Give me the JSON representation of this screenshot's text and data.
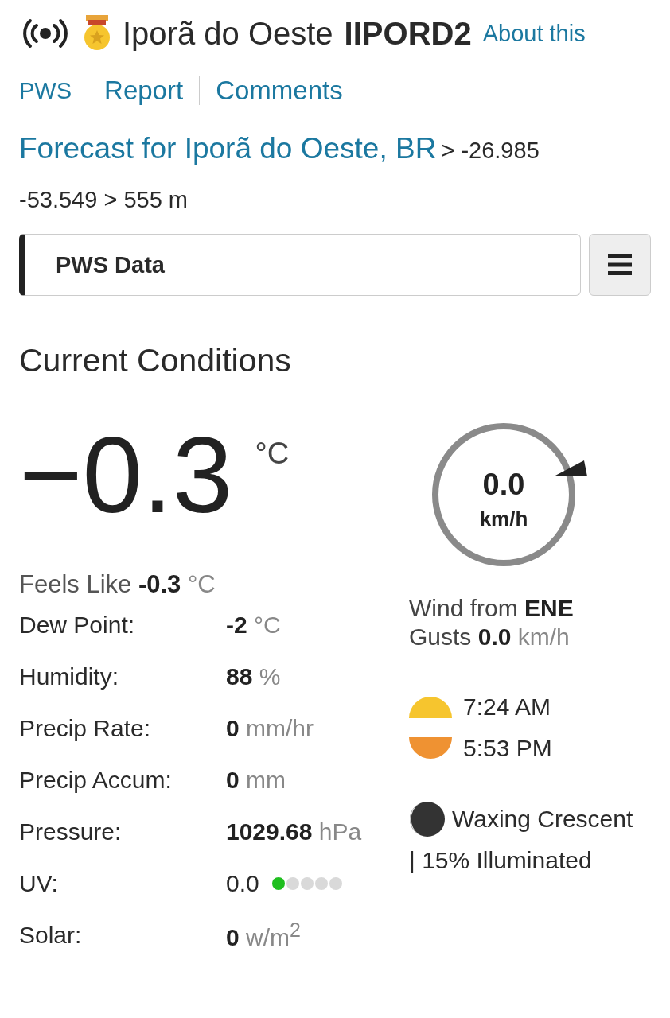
{
  "header": {
    "station_name": "Iporã do Oeste",
    "station_id": "IIPORD2",
    "about_link": "About this"
  },
  "nav": [
    {
      "label": "PWS"
    },
    {
      "label": "Report"
    },
    {
      "label": "Comments"
    }
  ],
  "forecast": {
    "link": "Forecast for Iporã do Oeste, BR",
    "location": "> -26.985 -53.549 > 555 m"
  },
  "data_menu": {
    "value": "PWS Data"
  },
  "section_title": "Current Conditions",
  "temperature": {
    "value": "−0.3",
    "unit": "°C"
  },
  "feels_like": {
    "label": "Feels Like",
    "value": "-0.3",
    "unit": "°C"
  },
  "rows": [
    {
      "kind": "value",
      "label": "Dew Point:",
      "value": "-2",
      "unit": "°C"
    },
    {
      "kind": "value",
      "label": "Humidity:",
      "value": "88",
      "unit": "%"
    },
    {
      "kind": "value",
      "label": "Precip Rate:",
      "value": "0",
      "unit": "mm/hr"
    },
    {
      "kind": "value",
      "label": "Precip Accum:",
      "value": "0",
      "unit": "mm"
    },
    {
      "kind": "value",
      "label": "Pressure:",
      "value": "1029.68",
      "unit": "hPa"
    },
    {
      "kind": "index",
      "label": "UV:",
      "value": "0.0",
      "dots": [
        {
          "color": "#1fbf1f"
        },
        {
          "color": "#d9d9d9"
        },
        {
          "color": "#d9d9d9"
        },
        {
          "color": "#d9d9d9"
        },
        {
          "color": "#d9d9d9"
        }
      ]
    },
    {
      "kind": "value",
      "label": "Solar:",
      "value": "0",
      "unit": "w/m$^{2}$"
    }
  ],
  "wind": {
    "speed": "0.0",
    "unit": "km/h",
    "from_label": "Wind from",
    "direction": "ENE",
    "gusts_label": "Gusts",
    "gusts": "0.0",
    "gusts_unit": "km/h"
  },
  "sun": [
    {
      "kind": "sunrise",
      "time": "7:24 AM"
    },
    {
      "kind": "sunset",
      "time": "5:53 PM"
    }
  ],
  "moon": {
    "phase": "Waxing Crescent",
    "illumination": "| 15% Illuminated"
  }
}
